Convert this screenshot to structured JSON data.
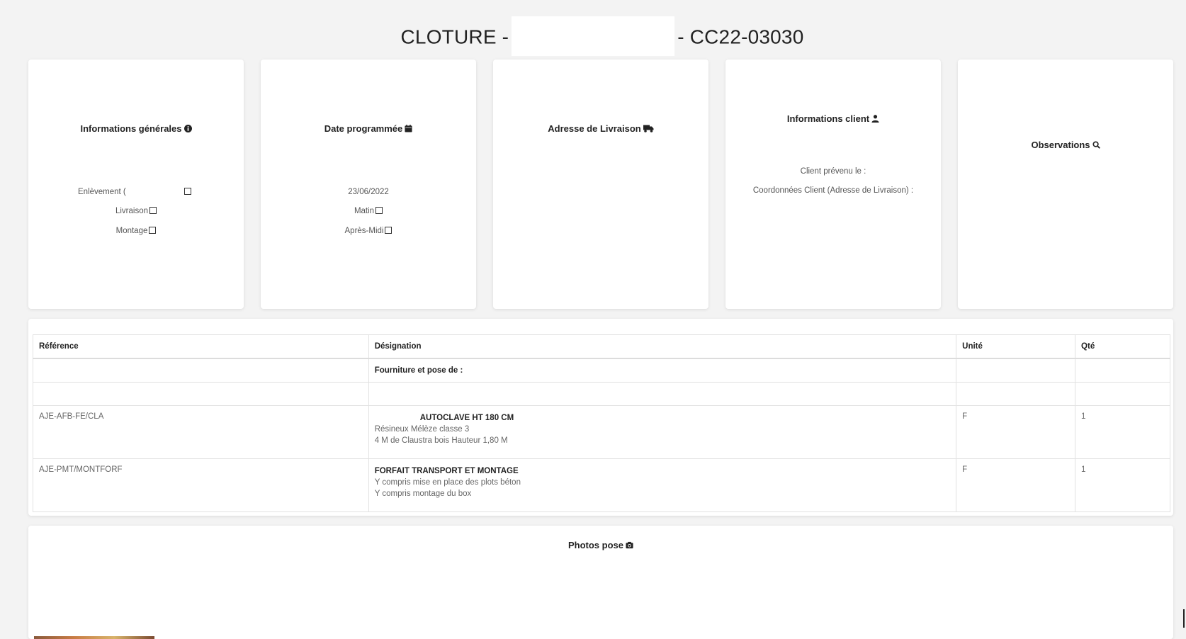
{
  "header": {
    "title_prefix": "CLOTURE -",
    "title_suffix": "- CC22-03030"
  },
  "cards": {
    "general": {
      "title": "Informations générales",
      "icon": "info-circle-icon",
      "items": [
        "Enlèvement (",
        "Livraison",
        "Montage"
      ]
    },
    "date": {
      "title": "Date programmée",
      "icon": "calendar-icon",
      "date": "23/06/2022",
      "items": [
        "Matin",
        "Après-Midi"
      ]
    },
    "address": {
      "title": "Adresse de Livraison",
      "icon": "truck-icon"
    },
    "client": {
      "title": "Informations client",
      "icon": "user-icon",
      "lines": [
        "Client prévenu le :",
        "Coordonnées Client (Adresse de Livraison) :"
      ]
    },
    "observations": {
      "title": "Observations",
      "icon": "search-icon"
    }
  },
  "table": {
    "columns": [
      "Référence",
      "Désignation",
      "Unité",
      "Qté"
    ],
    "section_label": "Fourniture et pose de :",
    "rows": [
      {
        "ref": "AJE-AFB-FE/CLA",
        "title": "AUTOCLAVE HT 180 CM",
        "lines": [
          "Résineux Mélèze classe 3",
          "4 M de Claustra bois Hauteur 1,80 M"
        ],
        "unit": "F",
        "qty": "1"
      },
      {
        "ref": "AJE-PMT/MONTFORF",
        "title": "FORFAIT TRANSPORT ET MONTAGE",
        "lines": [
          "Y compris mise en place des plots béton",
          "Y compris montage du box"
        ],
        "unit": "F",
        "qty": "1"
      }
    ]
  },
  "photos": {
    "title": "Photos pose",
    "icon": "camera-icon"
  }
}
